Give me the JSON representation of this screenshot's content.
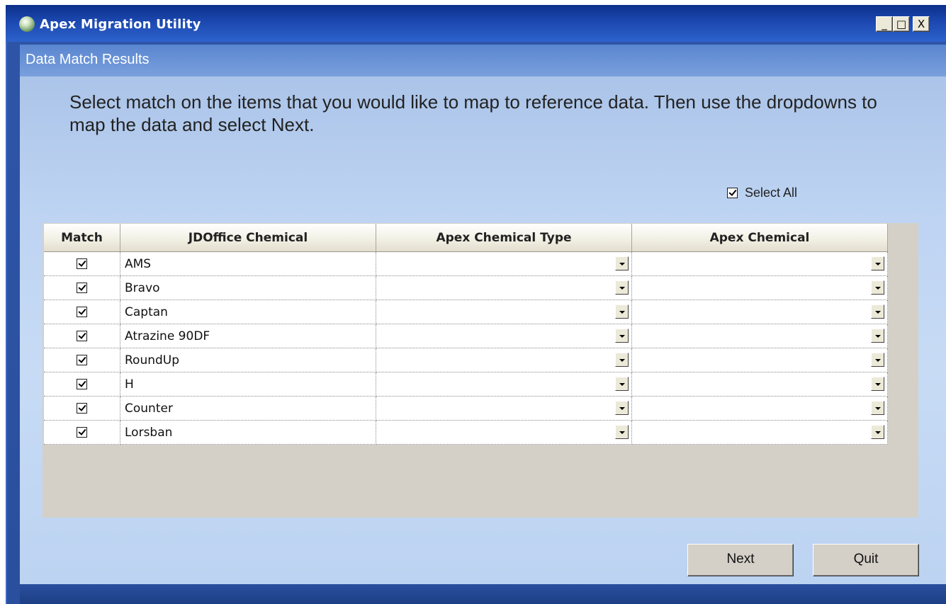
{
  "window": {
    "title": "Apex Migration Utility",
    "controls": {
      "minimize": "_",
      "maximize": "□",
      "close": "X"
    }
  },
  "page": {
    "header": "Data Match Results",
    "instructions": "Select match on the items that you would like to map to reference data.  Then use the dropdowns to map the data and select Next."
  },
  "select_all": {
    "label": "Select All",
    "checked": true
  },
  "grid": {
    "columns": [
      "Match",
      "JDOffice Chemical",
      "Apex Chemical Type",
      "Apex Chemical"
    ],
    "rows": [
      {
        "match": true,
        "jdoffice_chemical": "AMS",
        "apex_chemical_type": "",
        "apex_chemical": ""
      },
      {
        "match": true,
        "jdoffice_chemical": "Bravo",
        "apex_chemical_type": "",
        "apex_chemical": ""
      },
      {
        "match": true,
        "jdoffice_chemical": "Captan",
        "apex_chemical_type": "",
        "apex_chemical": ""
      },
      {
        "match": true,
        "jdoffice_chemical": "Atrazine 90DF",
        "apex_chemical_type": "",
        "apex_chemical": ""
      },
      {
        "match": true,
        "jdoffice_chemical": "RoundUp",
        "apex_chemical_type": "",
        "apex_chemical": ""
      },
      {
        "match": true,
        "jdoffice_chemical": "H",
        "apex_chemical_type": "",
        "apex_chemical": ""
      },
      {
        "match": true,
        "jdoffice_chemical": "Counter",
        "apex_chemical_type": "",
        "apex_chemical": ""
      },
      {
        "match": true,
        "jdoffice_chemical": "Lorsban",
        "apex_chemical_type": "",
        "apex_chemical": ""
      }
    ]
  },
  "buttons": {
    "next": "Next",
    "quit": "Quit"
  },
  "colors": {
    "title_bar": "#1c48b0",
    "content_bg": "#c7dbf5",
    "grid_bg": "#d4d0c8"
  },
  "icons": {
    "app": "globe-icon",
    "dropdown": "chevron-down-icon",
    "checkbox": "checkmark-icon"
  }
}
